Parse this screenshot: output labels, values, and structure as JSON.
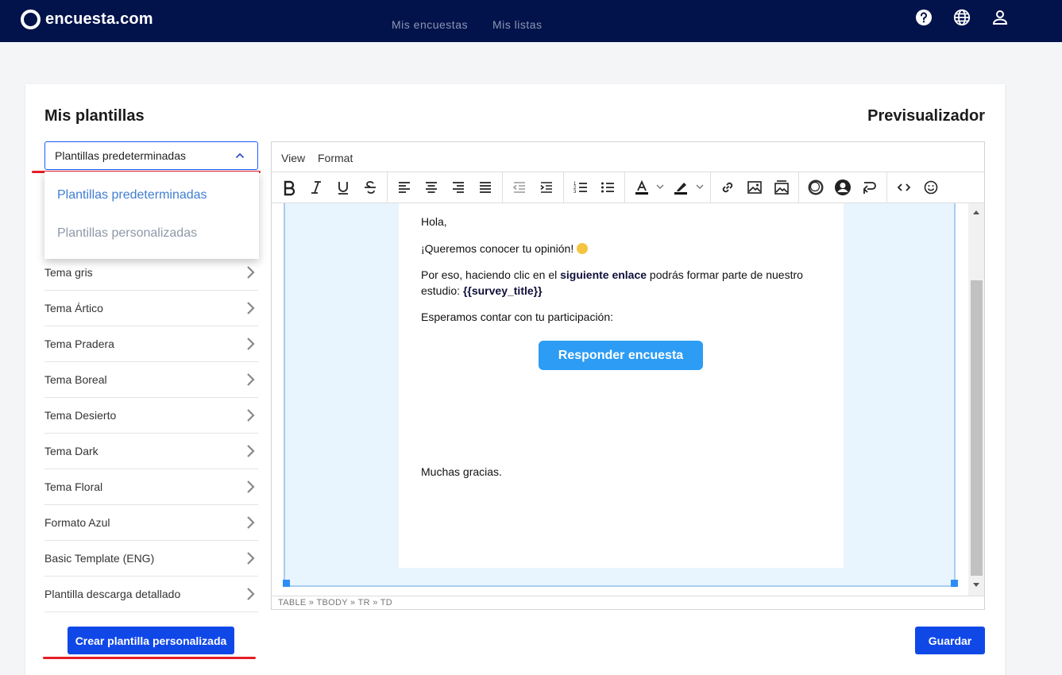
{
  "app": {
    "logo_text": "encuesta.com",
    "nav": [
      "Mis encuestas",
      "Mis listas"
    ]
  },
  "page": {
    "left_title": "Mis plantillas",
    "right_title": "Previsualizador"
  },
  "template_select": {
    "value": "Plantillas predeterminadas",
    "options": [
      "Plantillas predeterminadas",
      "Plantillas personalizadas"
    ]
  },
  "templates": [
    "Tema gris",
    "Tema Ártico",
    "Tema Pradera",
    "Tema Boreal",
    "Tema Desierto",
    "Tema Dark",
    "Tema Floral",
    "Formato Azul",
    "Basic Template (ENG)",
    "Plantilla descarga detallado"
  ],
  "buttons": {
    "create": "Crear plantilla personalizada",
    "save": "Guardar"
  },
  "editor": {
    "menu": [
      "View",
      "Format"
    ],
    "path": "TABLE » TBODY » TR » TD"
  },
  "email": {
    "greeting": "Hola,",
    "line1": "¡Queremos conocer tu opinión!",
    "line2_pre": "Por eso, haciendo clic en el ",
    "line2_bold": "siguiente enlace",
    "line2_post": " podrás formar parte de nuestro estudio: ",
    "line2_var": "{{survey_title}}",
    "line3": "Esperamos contar con tu participación:",
    "cta": "Responder encuesta",
    "closing": "Muchas gracias."
  },
  "colors": {
    "topbar": "#02134b",
    "primary_button": "#1048e8",
    "cta": "#2c9cf5",
    "highlight_red": "#e41e26"
  }
}
